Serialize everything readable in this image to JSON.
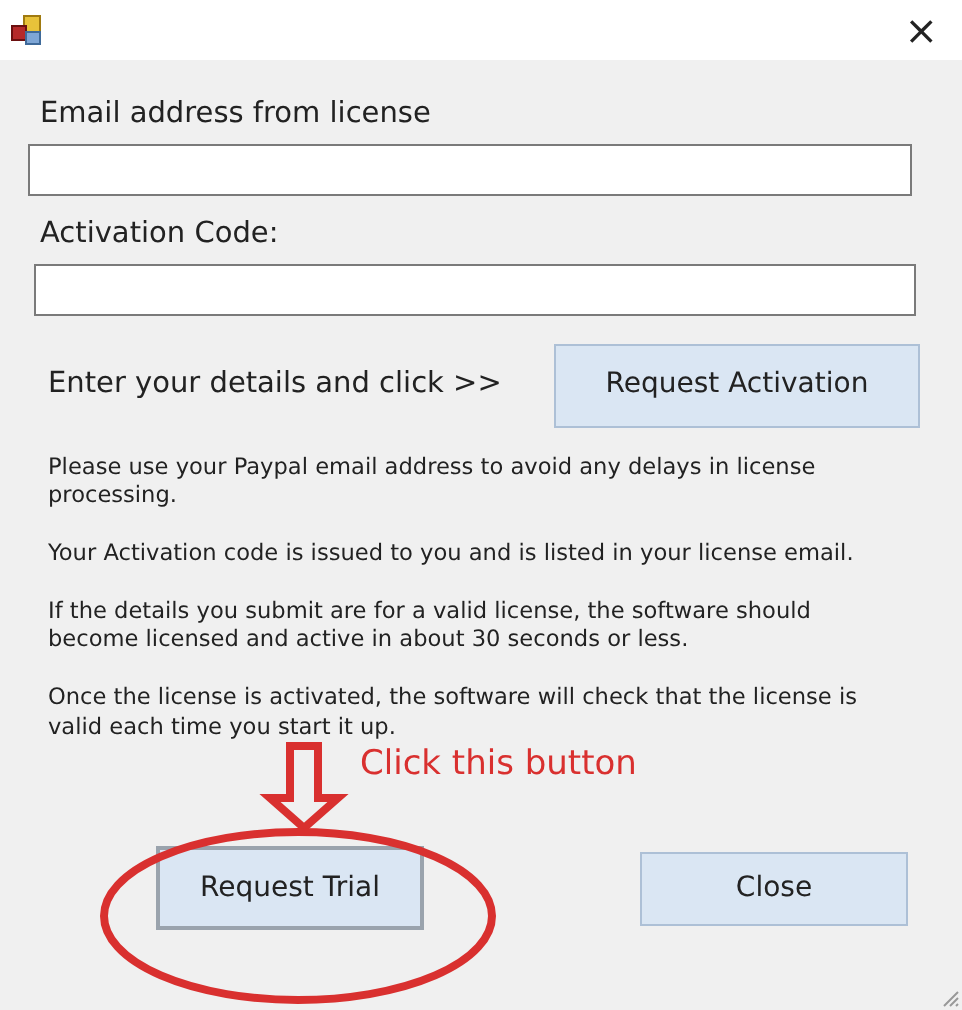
{
  "window": {
    "close": "×"
  },
  "fields": [
    {
      "label": "Email address from license"
    },
    {
      "label": "Activation Code:"
    }
  ],
  "prompt": "Enter your details and click >>",
  "request_button": "Request Activation",
  "notes": [
    "Please use your Paypal email address to avoid any delays in license processing.",
    "Your Activation code is issued to you and is listed in your license email.",
    "If the details you submit are for a valid license, the software should become licensed and active in about 30 seconds or less.",
    "Once the license is activated, the software will check that the license is valid each time you start it up."
  ],
  "annotation": {
    "text": "Click this button"
  },
  "buttons": [
    {
      "label": "Request Trial",
      "highlighted": true
    },
    {
      "label": "Close",
      "highlighted": false
    }
  ]
}
